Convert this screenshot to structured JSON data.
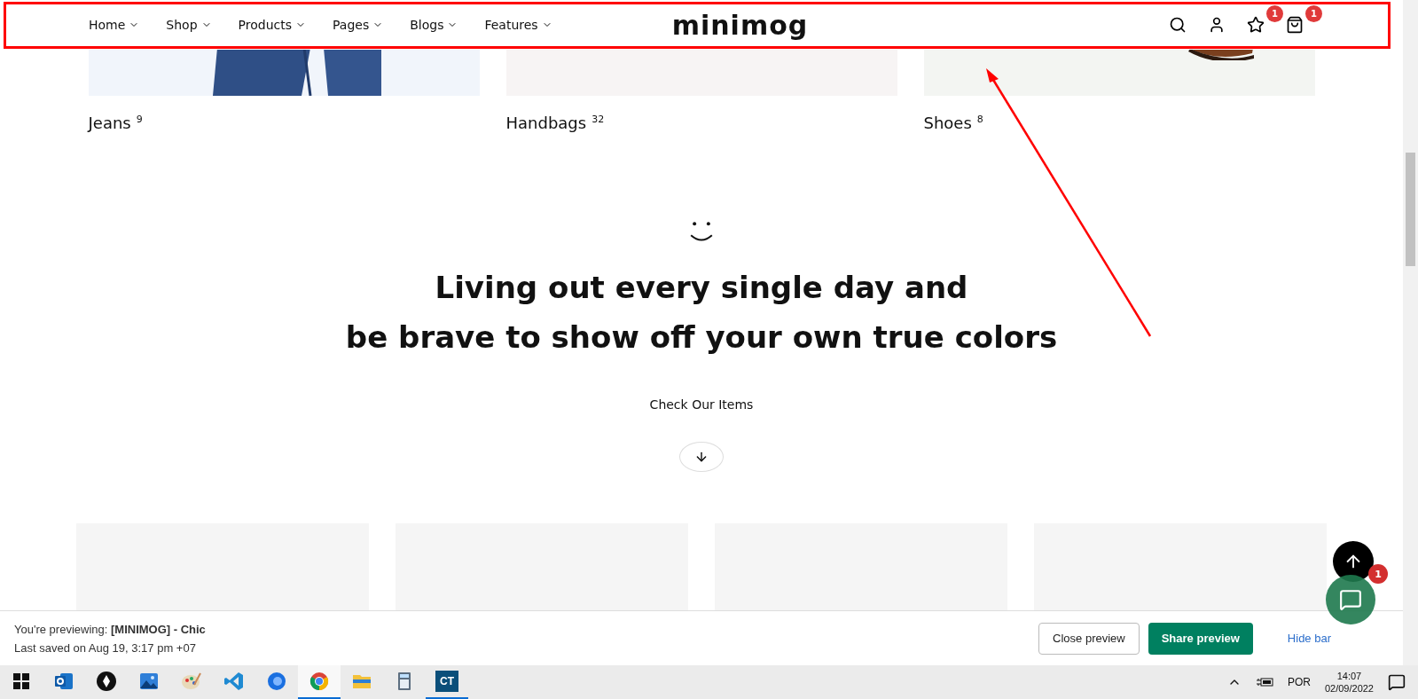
{
  "header": {
    "nav": [
      {
        "label": "Home"
      },
      {
        "label": "Shop"
      },
      {
        "label": "Products"
      },
      {
        "label": "Pages"
      },
      {
        "label": "Blogs"
      },
      {
        "label": "Features"
      }
    ],
    "logo": "minimog",
    "wishlist_badge": "1",
    "cart_badge": "1"
  },
  "categories": [
    {
      "name": "Jeans",
      "count": "9",
      "kind": "jeans"
    },
    {
      "name": "Handbags",
      "count": "32",
      "kind": "plain"
    },
    {
      "name": "Shoes",
      "count": "8",
      "kind": "shoes"
    }
  ],
  "headline": [
    "Living out every single day and",
    "be brave to show off your own true colors"
  ],
  "cta": "Check Our Items",
  "product_cards": [
    {
      "kind": "placeholder"
    },
    {
      "kind": "placeholder"
    },
    {
      "kind": "placeholder"
    },
    {
      "kind": "placeholder"
    }
  ],
  "chat_badge": "1",
  "preview_bar": {
    "line_1": "You're previewing: **[MINIMOG] - Chic**",
    "line_2": "Last saved on Aug 19, 3:17 pm +07",
    "buttons": [
      {
        "label": "Close preview",
        "kind": "outline"
      },
      {
        "label": "Share preview",
        "kind": "primary"
      },
      {
        "label": "Hide bar",
        "kind": "link"
      }
    ]
  },
  "taskbar": {
    "apps": [
      {
        "kind": "outlook",
        "selected": false,
        "running": false
      },
      {
        "kind": "pen",
        "selected": false,
        "running": false
      },
      {
        "kind": "photos",
        "selected": false,
        "running": false
      },
      {
        "kind": "paint",
        "selected": false,
        "running": false
      },
      {
        "kind": "vscode",
        "selected": false,
        "running": false
      },
      {
        "kind": "firefox",
        "selected": false,
        "running": false
      },
      {
        "kind": "chrome",
        "selected": true,
        "running": true
      },
      {
        "kind": "folder",
        "selected": false,
        "running": false
      },
      {
        "kind": "calculator",
        "selected": false,
        "running": false
      },
      {
        "kind": "ct",
        "selected": false,
        "running": true,
        "label": "CT"
      }
    ],
    "language": "POR",
    "time": "14:07",
    "date": "02/09/2022"
  }
}
